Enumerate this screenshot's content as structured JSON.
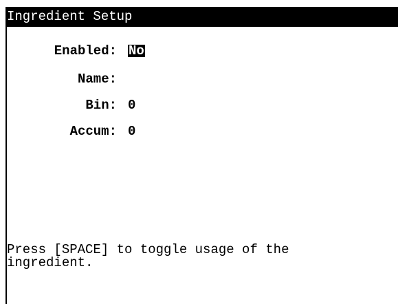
{
  "window": {
    "title": "Ingredient Setup"
  },
  "fields": {
    "enabled": {
      "label": "Enabled:",
      "value": "No"
    },
    "name": {
      "label": "Name:",
      "value": ""
    },
    "bin": {
      "label": "Bin:",
      "value": "0"
    },
    "accum": {
      "label": "Accum:",
      "value": "0"
    }
  },
  "help": {
    "text": "Press [SPACE] to toggle usage of the\ningredient."
  },
  "colors": {
    "background": "#ffffff",
    "foreground": "#000000",
    "highlight_bg": "#000000",
    "highlight_fg": "#ffffff"
  }
}
